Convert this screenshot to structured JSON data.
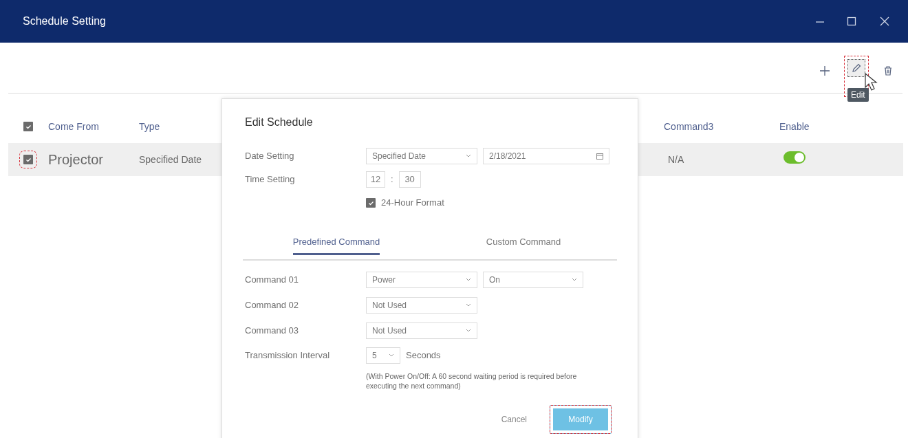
{
  "window": {
    "title": "Schedule Setting"
  },
  "toolbar": {
    "tools": [
      {
        "kind": "add",
        "highlighted": false
      },
      {
        "kind": "edit",
        "highlighted": true,
        "tooltip": "Edit"
      },
      {
        "kind": "delete",
        "highlighted": false
      }
    ]
  },
  "table": {
    "header_checked": true,
    "columns": [
      "Come From",
      "Type",
      "Command3",
      "Enable"
    ],
    "rows": [
      {
        "checked": true,
        "highlighted": true,
        "come_from": "Projector",
        "type": "Specified Date",
        "command3": "N/A",
        "enable": true
      }
    ]
  },
  "dialog": {
    "title": "Edit Schedule",
    "date_setting": {
      "label": "Date Setting",
      "value": "Specified Date",
      "date": "2/18/2021"
    },
    "time_setting": {
      "label": "Time Setting",
      "hour": "12",
      "separator": ":",
      "minute": "30"
    },
    "format": {
      "label": "24-Hour Format",
      "checked": true
    },
    "tabs": [
      {
        "label": "Predefined Command",
        "selected": true
      },
      {
        "label": "Custom Command",
        "selected": false
      }
    ],
    "commands": [
      {
        "label": "Command 01",
        "value": "Power",
        "option": "On"
      },
      {
        "label": "Command 02",
        "value": "Not Used"
      },
      {
        "label": "Command 03",
        "value": "Not Used"
      }
    ],
    "interval": {
      "label": "Transmission Interval",
      "value": "5",
      "unit": "Seconds"
    },
    "note": "(With Power On/Off: A 60 second waiting period is required before executing the next command)",
    "buttons": [
      {
        "label": "Cancel",
        "kind": "secondary",
        "highlighted": false
      },
      {
        "label": "Modify",
        "kind": "primary",
        "highlighted": true
      }
    ]
  }
}
